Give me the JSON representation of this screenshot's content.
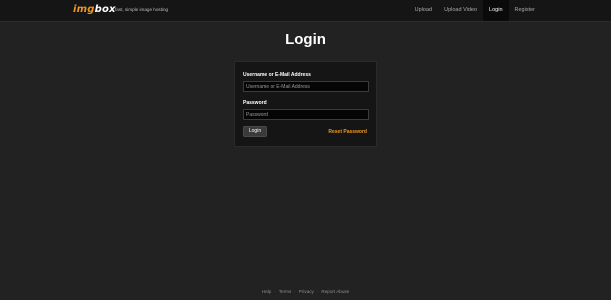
{
  "header": {
    "logo_img": "img",
    "logo_box": "box",
    "tagline": "fast, simple image hosting",
    "nav": [
      {
        "label": "Upload"
      },
      {
        "label": "Upload Video"
      },
      {
        "label": "Login"
      },
      {
        "label": "Register"
      }
    ],
    "active_nav": "Login"
  },
  "page": {
    "title": "Login"
  },
  "form": {
    "username_label": "Username or E-Mail Address",
    "username_placeholder": "Username or E-Mail Address",
    "username_value": "",
    "password_label": "Password",
    "password_placeholder": "Password",
    "password_value": "",
    "login_button": "Login",
    "reset_link": "Reset Password"
  },
  "footer": {
    "links": [
      {
        "label": "Help"
      },
      {
        "label": "Terms"
      },
      {
        "label": "Privacy"
      },
      {
        "label": "Report Abuse"
      }
    ],
    "separator": "·"
  },
  "colors": {
    "page_background": "#222222",
    "header_background": "#151515",
    "accent": "#f0961e",
    "panel_background": "#151515"
  }
}
